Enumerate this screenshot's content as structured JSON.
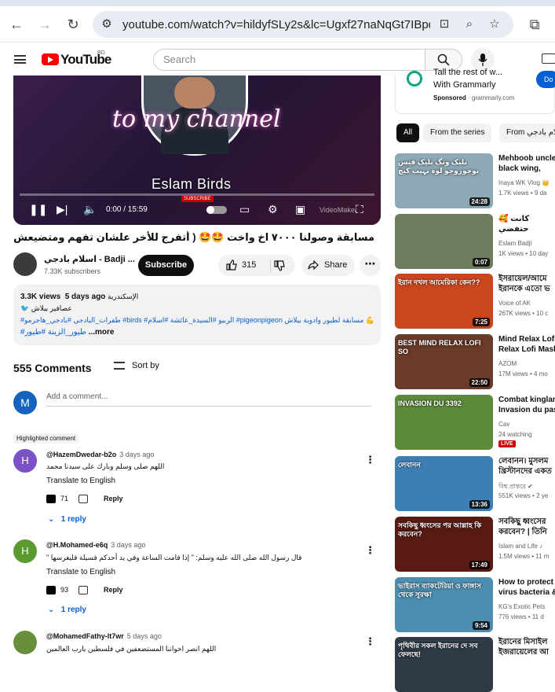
{
  "browser": {
    "url": "youtube.com/watch?v=hildyfSLy2s&lc=Ugxf27naNqGt7IBpqI..."
  },
  "masthead": {
    "logo_text": "YouTube",
    "country_code": "BD",
    "search_placeholder": "Search"
  },
  "video": {
    "overlay_text": "to my channel",
    "overlay_name": "Eslam Birds",
    "overlay_subscribe": "SUBSCRIBE",
    "time": "0:00 / 15:59",
    "watermark": "VideoMaker",
    "progress": 0,
    "title": "مسابقة وصولنا ٧٠٠٠ اخ واخت 🤩🤩 ( أتفرج للأخر علشان تفهم ومتضيعش تعبك ✌️ )"
  },
  "channel": {
    "name": "اسلام بادجي - Badji ...",
    "subscribers": "7.33K subscribers",
    "subscribe_label": "Subscribe"
  },
  "actions": {
    "like_count": "315",
    "share_label": "Share",
    "more_label": "⋯"
  },
  "description": {
    "views": "3.3K views",
    "date": "5 days ago",
    "location": "الإسكندرية",
    "line2": "🐦 عصافير بيلاش",
    "hashtags": "#طفرات_البادجي #بادجي_هاجرمو #birds #الربيو #السيدة_عائشة #اسلام #pigeonpigeon مسابقة لطيور وادوية بيلاش 💪",
    "line4": "#طيور_الزينة #طيور",
    "more": "...more"
  },
  "comments": {
    "count": "555 Comments",
    "sort_label": "Sort by",
    "my_initial": "M",
    "add_placeholder": "Add a comment...",
    "highlighted_label": "Highlighted comment",
    "items": [
      {
        "initial": "H",
        "color": "#7b52c5",
        "handle": "@HazemDwedar-b2o",
        "time": "3 days ago",
        "text": "اللهم صلى وسلم وبارك على سيدنا محمد",
        "translate": "Translate to English",
        "likes": "71",
        "reply_label": "Reply",
        "replies": "1 reply"
      },
      {
        "initial": "H",
        "color": "#5b9a2f",
        "handle": "@H.Mohamed-e6q",
        "time": "3 days ago",
        "text": "قال رسول الله صلى الله عليه وسلم: \" إذا قامت الساعة وفي يد أحدكم فسيلة فليغرسها \"",
        "translate": "Translate to English",
        "likes": "93",
        "reply_label": "Reply",
        "replies": "1 reply"
      },
      {
        "initial": "",
        "color": "#6a8f3c",
        "handle": "@MohamedFathy-lt7wr",
        "time": "5 days ago",
        "text": "اللهم انصر اخواننا المستضعفين في فلسطين يارب العالمين"
      }
    ]
  },
  "sidebar": {
    "ad": {
      "line1": "Tall the rest of w...",
      "line2": "With Grammarly",
      "sponsored": "Sponsored",
      "domain": "grammarly.com",
      "button": "Do"
    },
    "chips": [
      "All",
      "From the series",
      "From اسلام بادجي"
    ],
    "videos": [
      {
        "title": "Mehboob uncle black wing, black",
        "channel": "Inaya WK Vlog 👑",
        "meta": "1.7K views • 9 da",
        "duration": "24:28",
        "thumb": "#8da9b6",
        "thumb_text": "بلیک ونگ بلیک فیس بوجوروجو لوہ نہیت کیچ"
      },
      {
        "title": "🥰 كانت حتفضي",
        "channel": "Eslam Badji",
        "meta": "1K views • 10 day",
        "duration": "0:07",
        "thumb": "#6d7b5e",
        "thumb_text": ""
      },
      {
        "title": "ইসরায়েল/আমে ইরানকে এতো ভ",
        "channel": "Voice of AK",
        "meta": "267K views • 10 c",
        "duration": "7:25",
        "thumb": "#c9471f",
        "thumb_text": "ইরান দখল আমেরিকা কেন??"
      },
      {
        "title": "Mind Relax Lofi Relax Lofi Mash",
        "channel": "AZOM",
        "meta": "17M views • 4 mo",
        "duration": "22:50",
        "thumb": "#6a3a2a",
        "thumb_text": "BEST MIND RELAX LOFI SO"
      },
      {
        "title": "Combat kinglan Invasion du pas",
        "channel": "Cav",
        "meta": "24 watching",
        "duration": "",
        "live": "LIVE",
        "thumb": "#5c8a3a",
        "thumb_text": "INVASION DU 3392"
      },
      {
        "title": "লেবানন। মুসলম খ্রিস্টানদের একত",
        "channel": "বিশ্ব প্রান্তরে ✔",
        "meta": "551K views • 2 ye",
        "duration": "13:36",
        "thumb": "#3d7fb5",
        "thumb_text": "লেবানন"
      },
      {
        "title": "সবকিছু ধ্বংসের করবেন? | তিনি",
        "channel": "Islam and Life ♪",
        "meta": "1.5M views • 11 m",
        "duration": "17:49",
        "thumb": "#5a1a14",
        "thumb_text": "সবকিছু ধ্বংসের পর আল্লাহ কি করবেন?"
      },
      {
        "title": "How to protect virus bacteria &",
        "channel": "KG's Exotic Pets",
        "meta": "776 views • 11 d",
        "duration": "9:54",
        "thumb": "#4d8db0",
        "thumb_text": "ভাইরাস ব্যাকটেরিয়া ও ফাঙ্গাস থেকে সুরক্ষা"
      },
      {
        "title": "ইরানের মিসাইল ইজরায়েলের আ",
        "channel": "",
        "meta": "",
        "duration": "",
        "thumb": "#2e3a46",
        "thumb_text": "পৃথিবীর সকল ইরানের দে সব ফেলছে!"
      }
    ]
  }
}
